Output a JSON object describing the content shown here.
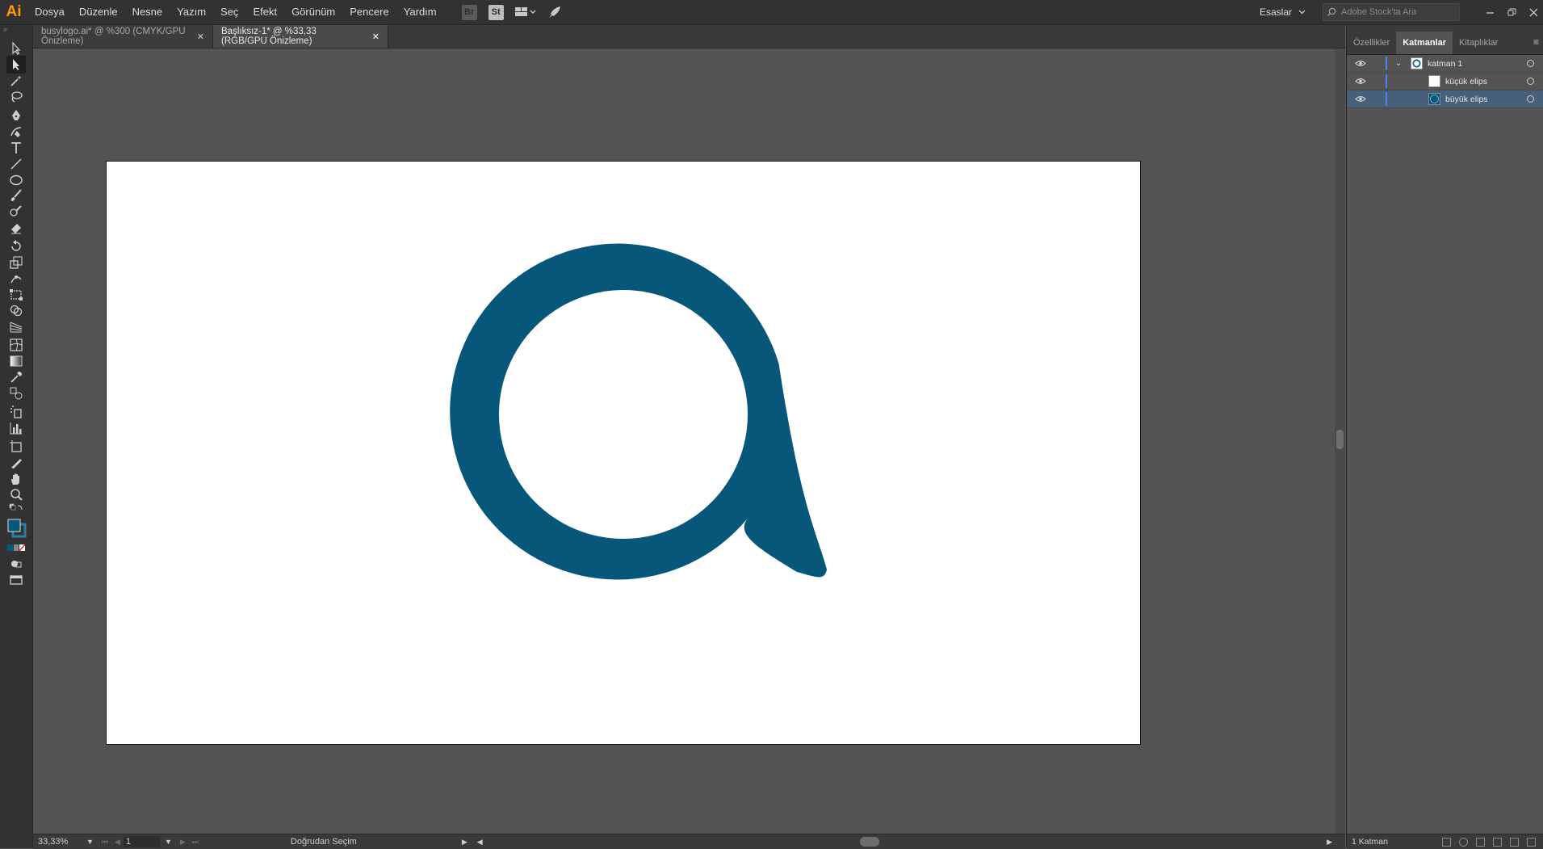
{
  "app": {
    "logo": "Ai",
    "accent": "#ff9a00"
  },
  "menu": [
    "Dosya",
    "Düzenle",
    "Nesne",
    "Yazım",
    "Seç",
    "Efekt",
    "Görünüm",
    "Pencere",
    "Yardım"
  ],
  "menubar_icons": {
    "bridge": "Br",
    "stock": "St"
  },
  "workspace": {
    "label": "Esaslar"
  },
  "search": {
    "placeholder": "Adobe Stock'ta Ara"
  },
  "tabs": [
    {
      "label": "busylogo.ai* @ %300 (CMYK/GPU Önizleme)",
      "active": false
    },
    {
      "label": "Başlıksız-1* @ %33,33 (RGB/GPU Önizleme)",
      "active": true
    }
  ],
  "status": {
    "zoom": "33,33%",
    "page": "1",
    "tool_name": "Doğrudan Seçim"
  },
  "artwork": {
    "logo_color": "#07577a"
  },
  "panel": {
    "tabs": [
      "Özellikler",
      "Katmanlar",
      "Kitaplıklar"
    ],
    "active_tab": "Katmanlar",
    "layers": [
      {
        "name": "katman 1",
        "level": 0,
        "expanded": true,
        "selected": false
      },
      {
        "name": "küçük elips",
        "level": 1,
        "selected": false
      },
      {
        "name": "büyük elips",
        "level": 1,
        "selected": true
      }
    ],
    "footer_label": "1 Katman",
    "selection_color": "#46607a",
    "layer_color": "#4f7fff"
  }
}
